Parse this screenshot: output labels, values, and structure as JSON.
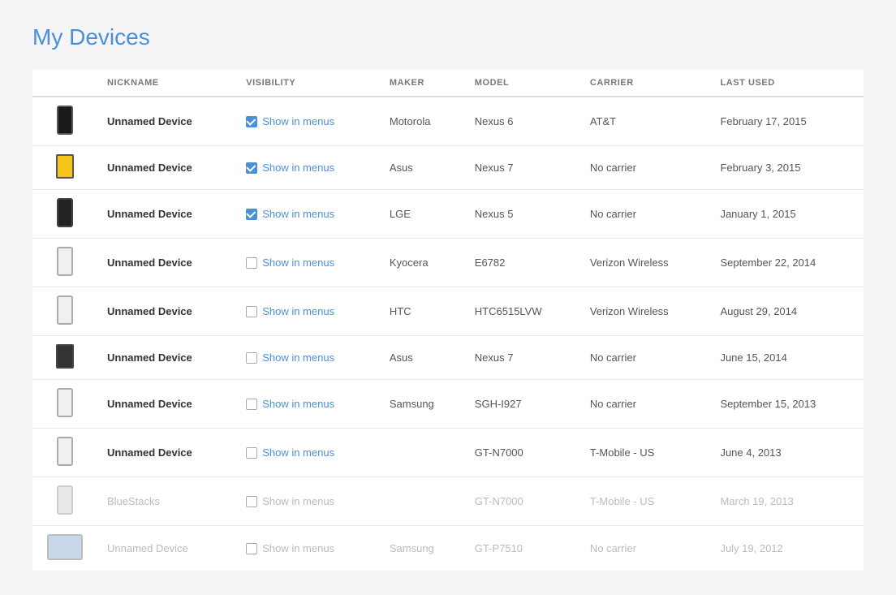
{
  "page": {
    "title": "My Devices"
  },
  "table": {
    "columns": {
      "device": "",
      "nickname": "NICKNAME",
      "visibility": "VISIBILITY",
      "maker": "MAKER",
      "model": "MODEL",
      "carrier": "CARRIER",
      "lastused": "LAST USED"
    },
    "rows": [
      {
        "id": 1,
        "deviceType": "phone-dark",
        "nickname": "Unnamed Device",
        "faded": false,
        "checked": true,
        "maker": "Motorola",
        "model": "Nexus 6",
        "carrier": "AT&T",
        "lastUsed": "February 17, 2015"
      },
      {
        "id": 2,
        "deviceType": "tablet-small-dark",
        "nickname": "Unnamed Device",
        "faded": false,
        "checked": true,
        "maker": "Asus",
        "model": "Nexus 7",
        "carrier": "No carrier",
        "lastUsed": "February 3, 2015"
      },
      {
        "id": 3,
        "deviceType": "phone-dark2",
        "nickname": "Unnamed Device",
        "faded": false,
        "checked": true,
        "maker": "LGE",
        "model": "Nexus 5",
        "carrier": "No carrier",
        "lastUsed": "January 1, 2015"
      },
      {
        "id": 4,
        "deviceType": "phone-light",
        "nickname": "Unnamed Device",
        "faded": false,
        "checked": false,
        "maker": "Kyocera",
        "model": "E6782",
        "carrier": "Verizon Wireless",
        "lastUsed": "September 22, 2014"
      },
      {
        "id": 5,
        "deviceType": "phone-light",
        "nickname": "Unnamed Device",
        "faded": false,
        "checked": false,
        "maker": "HTC",
        "model": "HTC6515LVW",
        "carrier": "Verizon Wireless",
        "lastUsed": "August 29, 2014"
      },
      {
        "id": 6,
        "deviceType": "tablet-small-dark2",
        "nickname": "Unnamed Device",
        "faded": false,
        "checked": false,
        "maker": "Asus",
        "model": "Nexus 7",
        "carrier": "No carrier",
        "lastUsed": "June 15, 2014"
      },
      {
        "id": 7,
        "deviceType": "phone-light",
        "nickname": "Unnamed Device",
        "faded": false,
        "checked": false,
        "maker": "Samsung",
        "model": "SGH-I927",
        "carrier": "No carrier",
        "lastUsed": "September 15, 2013"
      },
      {
        "id": 8,
        "deviceType": "phone-light",
        "nickname": "Unnamed Device",
        "faded": false,
        "checked": false,
        "maker": "",
        "model": "GT-N7000",
        "carrier": "T-Mobile - US",
        "lastUsed": "June 4, 2013"
      },
      {
        "id": 9,
        "deviceType": "phone-light-faded",
        "nickname": "BlueStacks",
        "faded": true,
        "checked": false,
        "maker": "",
        "model": "GT-N7000",
        "carrier": "T-Mobile - US",
        "lastUsed": "March 19, 2013"
      },
      {
        "id": 10,
        "deviceType": "tablet-landscape",
        "nickname": "Unnamed Device",
        "faded": true,
        "checked": false,
        "maker": "Samsung",
        "model": "GT-P7510",
        "carrier": "No carrier",
        "lastUsed": "July 19, 2012"
      }
    ]
  }
}
